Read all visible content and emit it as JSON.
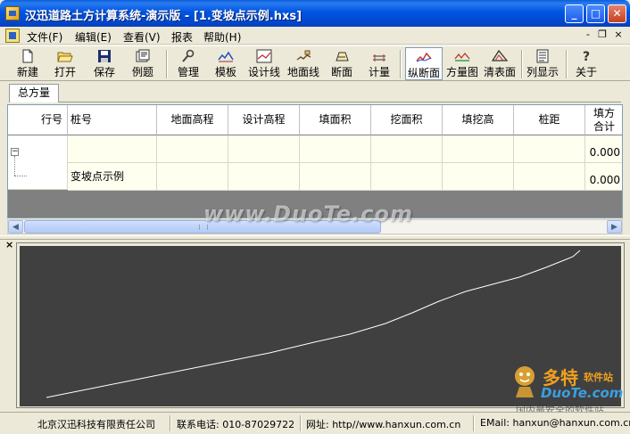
{
  "window": {
    "title": "汉迅道路土方计算系统-演示版 - [1.变坡点示例.hxs]",
    "controls": {
      "minimize": "_",
      "maximize": "□",
      "close": "✕"
    }
  },
  "menu": {
    "items": [
      "文件(F)",
      "编辑(E)",
      "查看(V)",
      "报表",
      "帮助(H)"
    ],
    "mdi": {
      "minimize": "-",
      "restore": "❐",
      "close": "×"
    }
  },
  "toolbar": {
    "buttons": [
      {
        "label": "新建",
        "icon": "new-doc-icon"
      },
      {
        "label": "打开",
        "icon": "open-folder-icon"
      },
      {
        "label": "保存",
        "icon": "save-disk-icon"
      },
      {
        "label": "例题",
        "icon": "examples-icon"
      },
      {
        "label": "管理",
        "icon": "wrench-icon"
      },
      {
        "label": "模板",
        "icon": "template-icon"
      },
      {
        "label": "设计线",
        "icon": "design-line-icon"
      },
      {
        "label": "地面线",
        "icon": "ground-line-icon"
      },
      {
        "label": "断面",
        "icon": "section-icon"
      },
      {
        "label": "计量",
        "icon": "measure-icon"
      },
      {
        "label": "纵断面",
        "icon": "profile-icon",
        "active": true
      },
      {
        "label": "方量图",
        "icon": "volume-chart-icon"
      },
      {
        "label": "清表面",
        "icon": "clear-surface-icon"
      },
      {
        "label": "列显示",
        "icon": "column-display-icon"
      },
      {
        "label": "关于",
        "icon": "help-question-icon"
      }
    ]
  },
  "tabs": {
    "active": "总方量"
  },
  "grid": {
    "columns": [
      "行号",
      "桩号",
      "地面高程",
      "设计高程",
      "填面积",
      "挖面积",
      "填挖高",
      "桩距"
    ],
    "last_column": {
      "line1": "填方",
      "line2": "合计"
    },
    "rows": [
      {
        "station": "",
        "fill_total": "0.000"
      },
      {
        "station": "变坡点示例",
        "fill_total": "0.000"
      }
    ]
  },
  "status": {
    "company": "北京汉迅科技有限责任公司",
    "phone": "联系电话: 010-87029722",
    "website": "网址: http//www.hanxun.com.cn",
    "email": "EMail: hanxun@hanxun.com.cn"
  },
  "watermark": {
    "center": "www.DuoTe.com",
    "logo_main": "多特",
    "logo_sub": "软件站",
    "logo_domain": "DuoTe.com",
    "logo_tag": "国内最安全的软件站"
  },
  "colors": {
    "titlebar": "#0054e3",
    "grid_row_bg": "#fffff0",
    "chart_bg": "#404040",
    "chart_line": "#ffffff"
  }
}
